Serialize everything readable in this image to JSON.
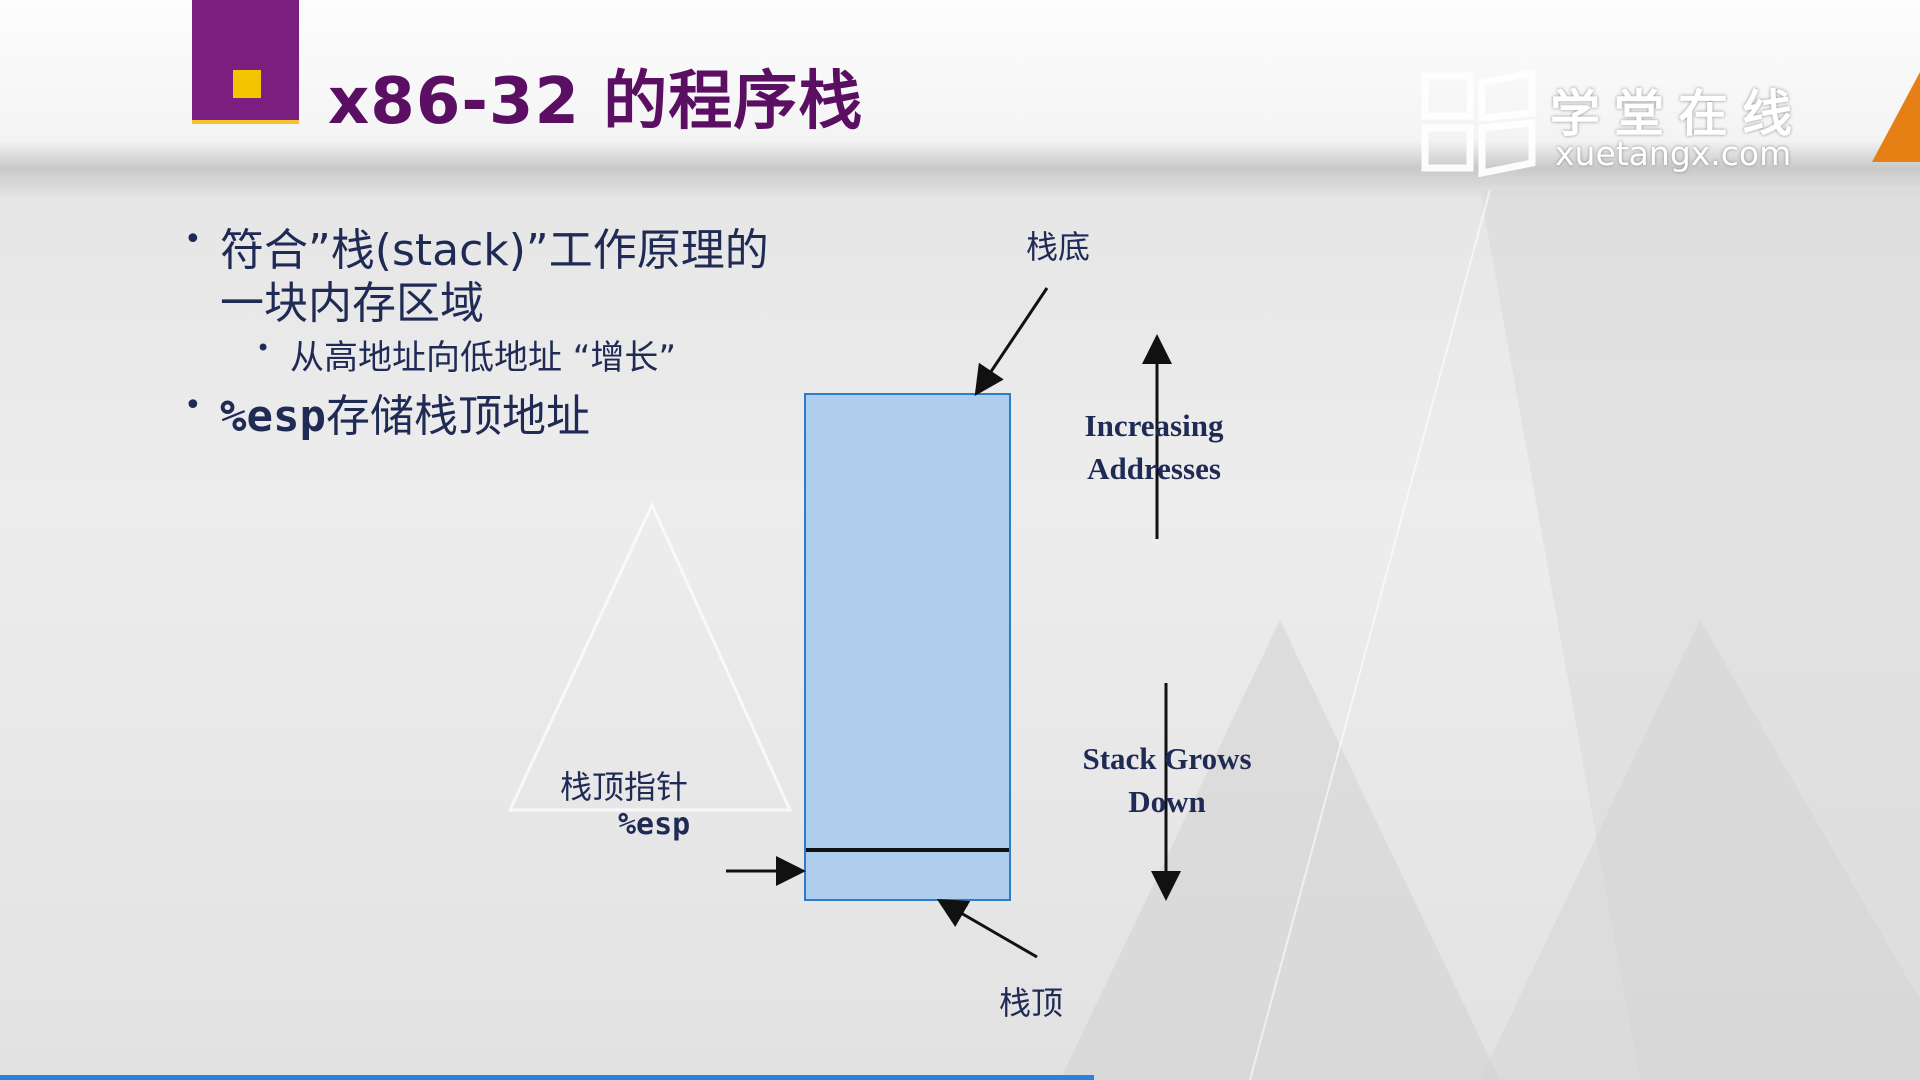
{
  "header": {
    "title": "x86-32 的程序栈",
    "accent_color": "#7a1f80",
    "marker_color": "#f5c400"
  },
  "logo": {
    "name_cn": "学堂在线",
    "domain": "xuetangx.com"
  },
  "bullets": [
    {
      "line1": "符合”栈(stack)”工作原理的",
      "line2": "一块内存区域",
      "sub": "从高地址向低地址 “增长”"
    },
    {
      "code": "%esp",
      "text": "存储栈顶地址"
    }
  ],
  "diagram": {
    "stack_bottom": "栈底",
    "stack_top": "栈顶",
    "pointer_label": "栈顶指针",
    "pointer_reg": "%esp",
    "increasing": [
      "Increasing",
      "Addresses"
    ],
    "grows": [
      "Stack Grows",
      "Down"
    ],
    "stack_fill": "#aeccec",
    "stack_border": "#2e7cc9"
  },
  "video": {
    "progress_percent": 57,
    "progress_color": "#2a82e0"
  }
}
